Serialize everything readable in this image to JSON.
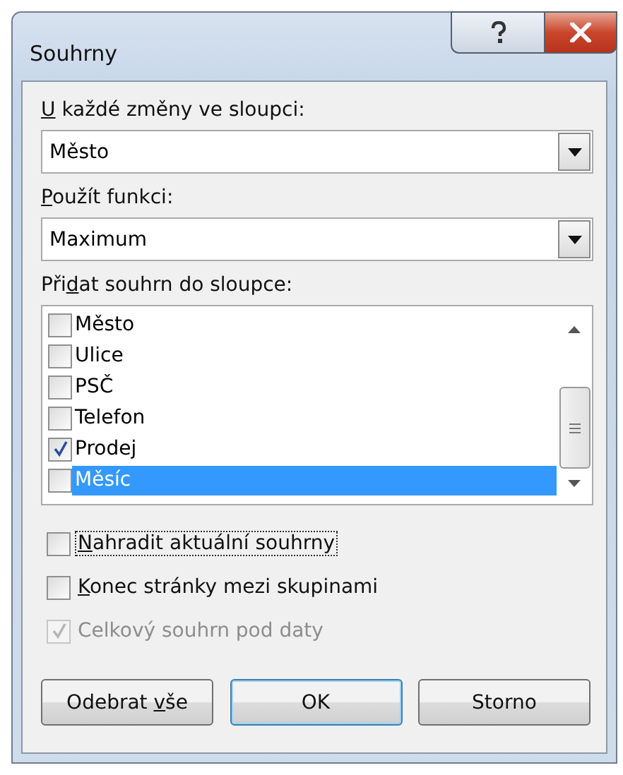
{
  "window": {
    "title": "Souhrny"
  },
  "dropdowns": [
    {
      "label": {
        "key": "U",
        "after": " každé změny ve sloupci:"
      },
      "value": "Město"
    },
    {
      "label": {
        "key": "P",
        "after": "oužít funkci:"
      },
      "value": "Maximum"
    }
  ],
  "column_list": {
    "label": {
      "before": "Při",
      "key": "d",
      "after": "at souhrn do sloupce:"
    },
    "items": [
      {
        "text": "Město",
        "checked": false,
        "selected": false
      },
      {
        "text": "Ulice",
        "checked": false,
        "selected": false
      },
      {
        "text": "PSČ",
        "checked": false,
        "selected": false
      },
      {
        "text": "Telefon",
        "checked": false,
        "selected": false
      },
      {
        "text": "Prodej",
        "checked": true,
        "selected": false
      },
      {
        "text": "Měsíc",
        "checked": false,
        "selected": true
      }
    ]
  },
  "options": [
    {
      "label": {
        "key": "N",
        "after": "ahradit aktuální souhrny"
      },
      "checked": false,
      "disabled": false,
      "focused": true
    },
    {
      "label": {
        "key": "K",
        "after": "onec stránky mezi skupinami"
      },
      "checked": false,
      "disabled": false,
      "focused": false
    },
    {
      "label": {
        "before": "Celkový souhrn pod daty"
      },
      "checked": true,
      "disabled": true,
      "focused": false
    }
  ],
  "buttons": [
    {
      "label": {
        "before": "Odebrat ",
        "key": "v",
        "after": "še"
      },
      "default": false
    },
    {
      "label": {
        "before": "OK"
      },
      "default": true
    },
    {
      "label": {
        "before": "Storno"
      },
      "default": false
    }
  ]
}
